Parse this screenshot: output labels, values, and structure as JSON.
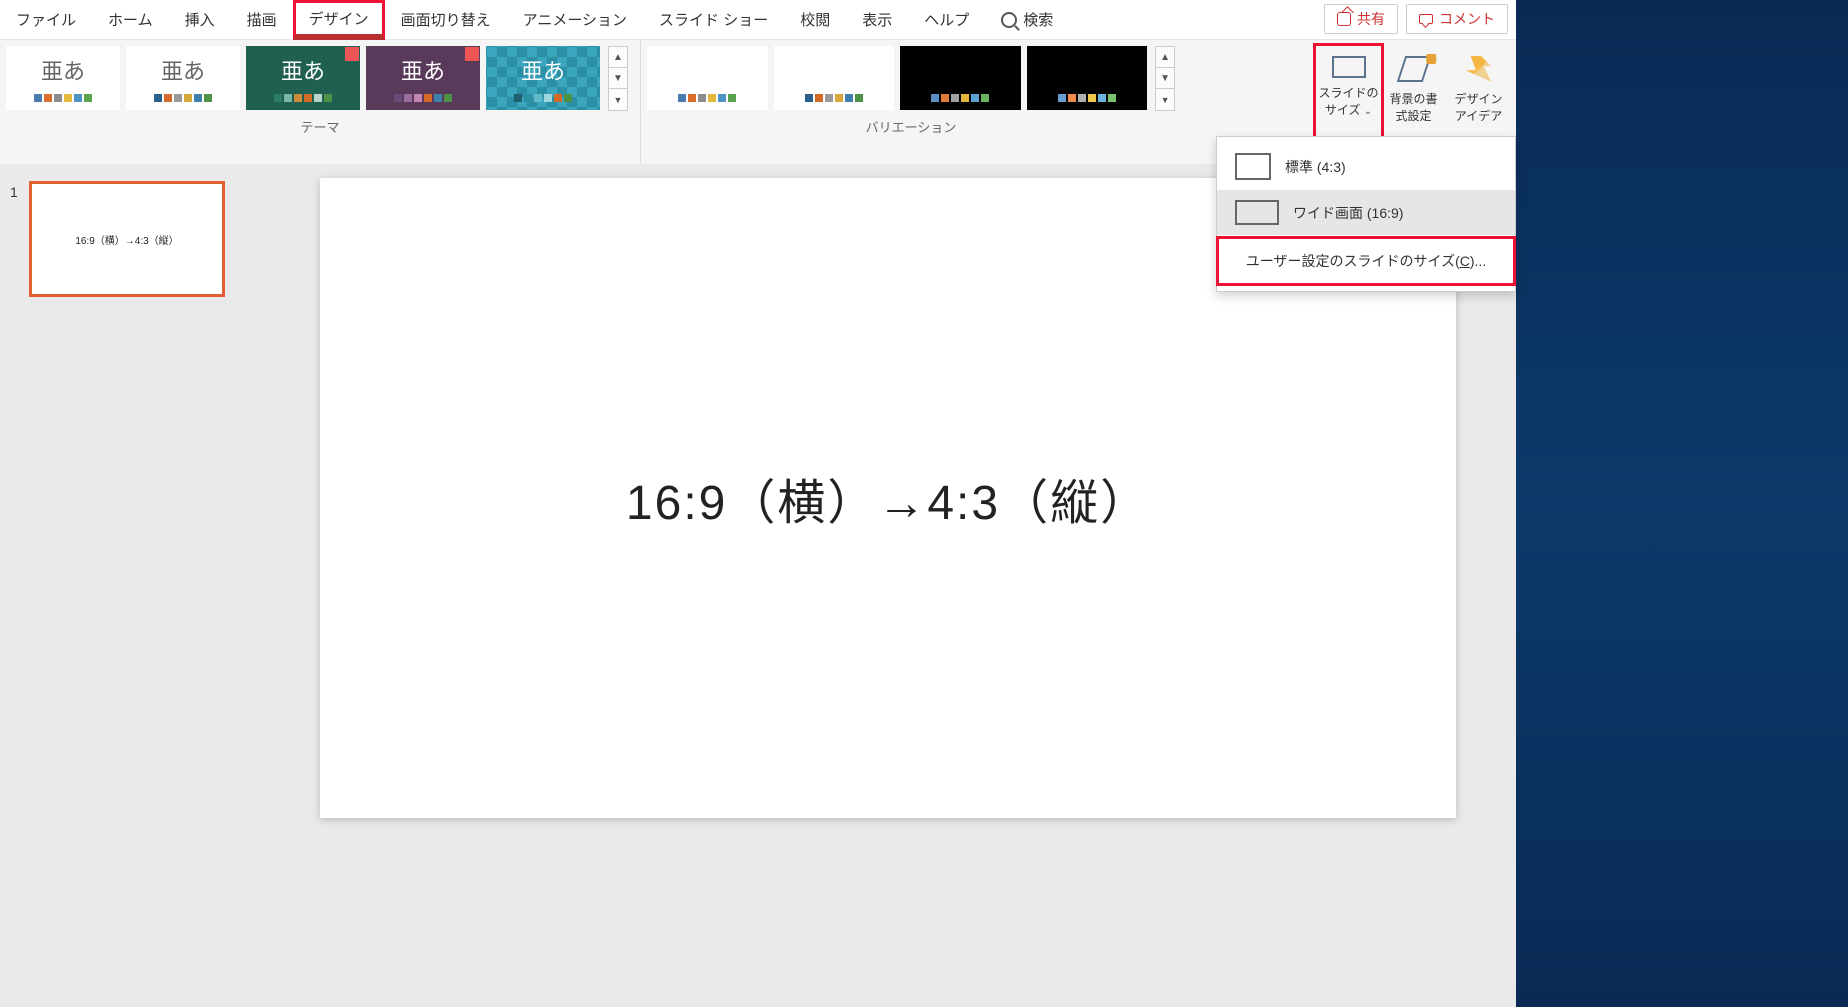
{
  "tabs": {
    "file": "ファイル",
    "home": "ホーム",
    "insert": "挿入",
    "draw": "描画",
    "design": "デザイン",
    "transition": "画面切り替え",
    "animation": "アニメーション",
    "slideshow": "スライド ショー",
    "review": "校閲",
    "view": "表示",
    "help": "ヘルプ",
    "search": "検索"
  },
  "rightButtons": {
    "share": "共有",
    "comment": "コメント"
  },
  "ribbon": {
    "themes_label": "テーマ",
    "variation_label": "バリエーション",
    "theme_sample": "亜あ",
    "slideSize": {
      "label_l1": "スライドの",
      "label_l2": "サイズ"
    },
    "formatBg": {
      "l1": "背景の書",
      "l2": "式設定"
    },
    "designIdeas": {
      "l1": "デザイン",
      "l2": "アイデア"
    }
  },
  "menu": {
    "standard": "標準 (4:3)",
    "wide": "ワイド画面 (16:9)",
    "custom_pre": "ユーザー設定のスライドのサイズ(",
    "custom_key": "C",
    "custom_post": ")..."
  },
  "panel": {
    "slide_number": "1",
    "thumb_text": "16:9（横）→4:3（縦）"
  },
  "canvas": {
    "text": "16:9（横）→4:3（縦）"
  },
  "palette": {
    "p1": [
      "#4a7ab0",
      "#d96f2b",
      "#8c8c8c",
      "#e5b83c",
      "#4f93c4",
      "#5aa34f"
    ],
    "p2": [
      "#2b5f8c",
      "#d46a2a",
      "#999",
      "#d9a83a",
      "#3e7fae",
      "#4e9245"
    ],
    "p3": [
      "#2f7d68",
      "#78b7a4",
      "#d08c3a",
      "#d46a2a",
      "#b7d6c8",
      "#4e9245"
    ],
    "p4": [
      "#6a4a78",
      "#9b6ca0",
      "#c487b2",
      "#d46a2a",
      "#3e7fae",
      "#4e9245"
    ],
    "p5": [
      "#1f5f6e",
      "#2b8fa6",
      "#62b9c9",
      "#9cd7df",
      "#d46a2a",
      "#4e9245"
    ],
    "v1": [
      "#4a7ab0",
      "#d96f2b",
      "#8c8c8c",
      "#e5b83c",
      "#4f93c4",
      "#5aa34f"
    ],
    "v2": [
      "#2b5f8c",
      "#d46a2a",
      "#999",
      "#d9a83a",
      "#3e7fae",
      "#4e9245"
    ],
    "v3": [
      "#5a8dc0",
      "#e07b3a",
      "#a0a0a0",
      "#e5b83c",
      "#5aa3d0",
      "#6ab35f"
    ],
    "v4": [
      "#6a9dd0",
      "#f08b4a",
      "#b0b0b0",
      "#f0c84c",
      "#6ab3e0",
      "#7ac36f"
    ]
  }
}
